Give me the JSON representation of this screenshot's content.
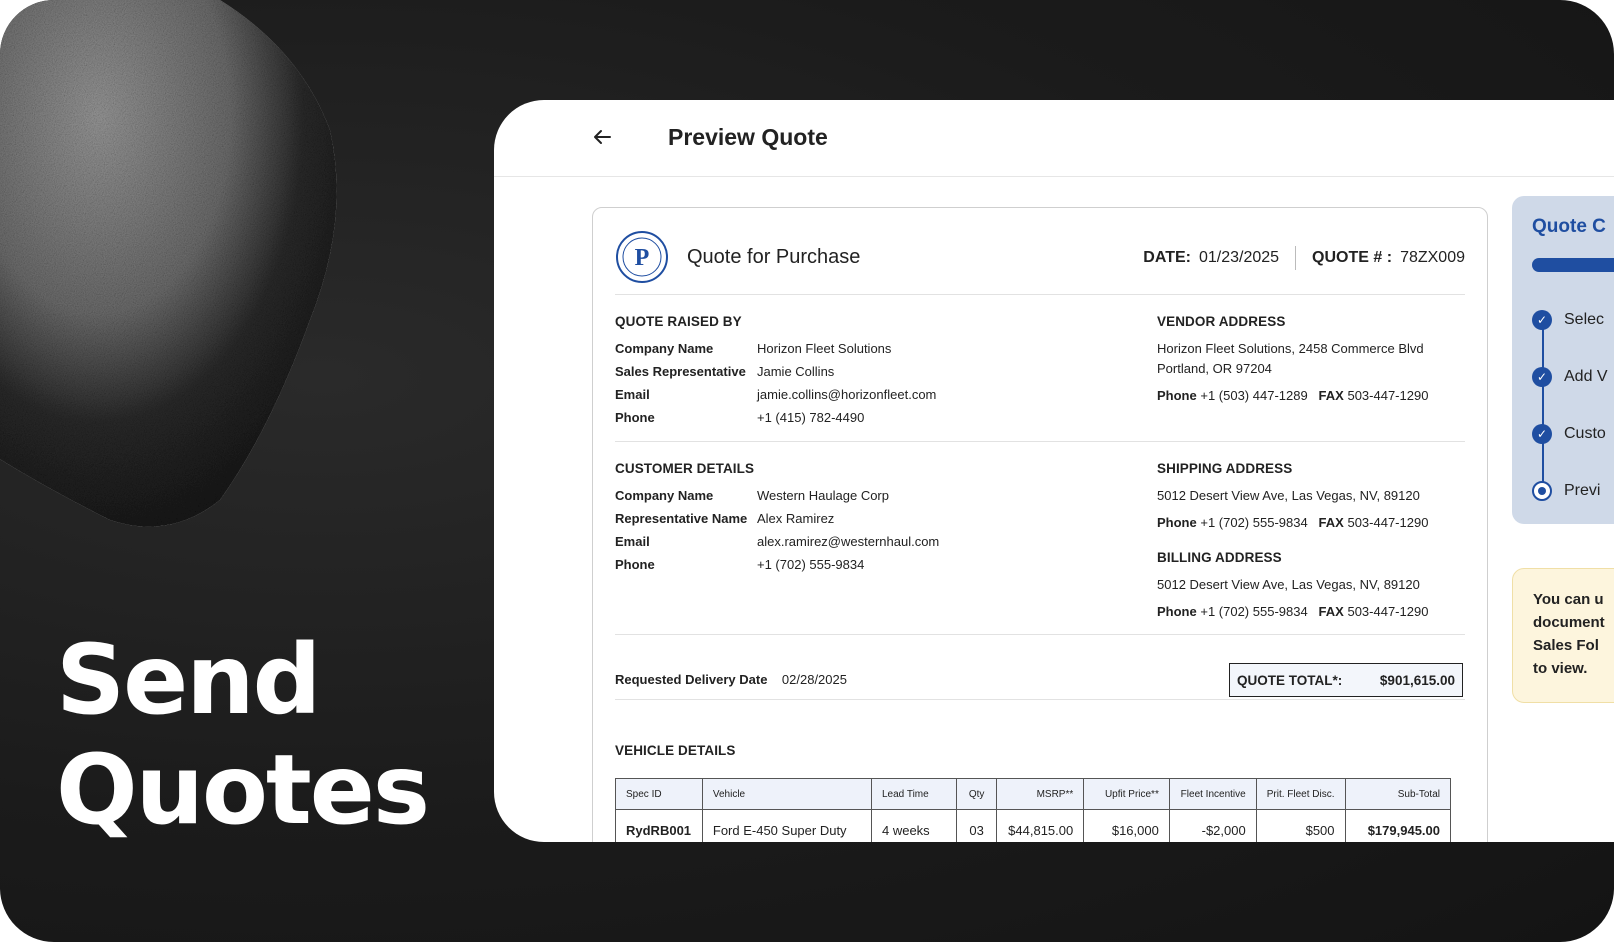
{
  "hero": {
    "line1": "Send",
    "line2": "Quotes"
  },
  "header": {
    "title": "Preview Quote"
  },
  "quote": {
    "title": "Quote for Purchase",
    "date_label": "DATE:",
    "date_value": "01/23/2025",
    "number_label": "QUOTE # :",
    "number_value": "78ZX009",
    "raised_by": {
      "heading": "QUOTE RAISED BY",
      "rows": [
        {
          "label": "Company Name",
          "value": "Horizon Fleet Solutions"
        },
        {
          "label": "Sales Representative",
          "value": "Jamie Collins"
        },
        {
          "label": "Email",
          "value": "jamie.collins@horizonfleet.com"
        },
        {
          "label": "Phone",
          "value": "+1 (415) 782-4490"
        }
      ]
    },
    "vendor": {
      "heading": "VENDOR ADDRESS",
      "line1": "Horizon Fleet Solutions, 2458 Commerce Blvd",
      "line2": "Portland, OR 97204",
      "phone_label": "Phone",
      "phone": "+1 (503) 447-1289",
      "fax_label": "FAX",
      "fax": "503-447-1290"
    },
    "customer": {
      "heading": "CUSTOMER DETAILS",
      "rows": [
        {
          "label": "Company Name",
          "value": "Western Haulage Corp"
        },
        {
          "label": "Representative Name",
          "value": "Alex Ramirez"
        },
        {
          "label": "Email",
          "value": "alex.ramirez@westernhaul.com"
        },
        {
          "label": "Phone",
          "value": "+1 (702) 555-9834"
        }
      ]
    },
    "shipping": {
      "heading": "SHIPPING ADDRESS",
      "line1": "5012 Desert View Ave, Las Vegas, NV, 89120",
      "phone_label": "Phone",
      "phone": "+1 (702) 555-9834",
      "fax_label": "FAX",
      "fax": "503-447-1290"
    },
    "billing": {
      "heading": "BILLING ADDRESS",
      "line1": "5012 Desert View Ave, Las Vegas, NV, 89120",
      "phone_label": "Phone",
      "phone": "+1 (702) 555-9834",
      "fax_label": "FAX",
      "fax": "503-447-1290"
    },
    "delivery_label": "Requested Delivery Date",
    "delivery_value": "02/28/2025",
    "total_label": "QUOTE TOTAL*:",
    "total_value": "$901,615.00",
    "vehicle_heading": "VEHICLE DETAILS",
    "table": {
      "headers": [
        "Spec ID",
        "Vehicle",
        "Lead Time",
        "Qty",
        "MSRP**",
        "Upfit Price**",
        "Fleet Incentive",
        "Prit. Fleet Disc.",
        "Sub-Total"
      ],
      "rows": [
        [
          "RydRB001",
          "Ford E-450 Super Duty",
          "4 weeks",
          "03",
          "$44,815.00",
          "$16,000",
          "-$2,000",
          "$500",
          "$179,945.00"
        ]
      ]
    }
  },
  "sidebar": {
    "title": "Quote C",
    "steps": [
      {
        "label": "Selec",
        "state": "done"
      },
      {
        "label": "Add V",
        "state": "done"
      },
      {
        "label": "Custo",
        "state": "done"
      },
      {
        "label": "Previ",
        "state": "current"
      }
    ]
  },
  "note": {
    "lines": [
      "You can u",
      "document",
      "Sales Fol",
      "to view."
    ]
  },
  "colors": {
    "accent": "#1f4ea1",
    "background": "#1b1b1b",
    "note_bg": "#fdf5dd"
  }
}
